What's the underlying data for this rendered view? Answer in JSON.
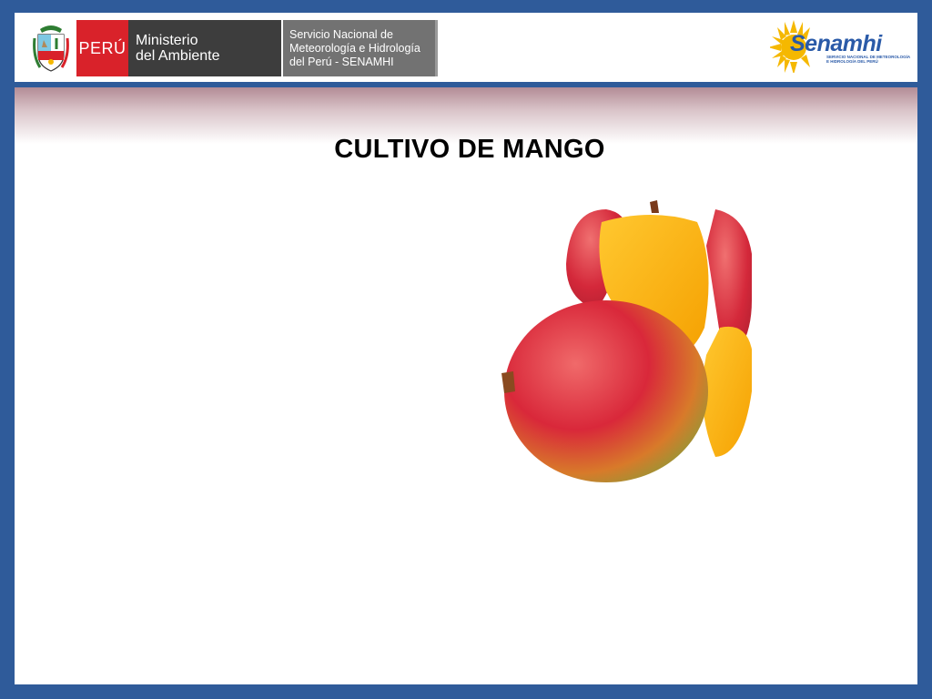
{
  "header": {
    "peru_label": "PERÚ",
    "ministry_line1": "Ministerio",
    "ministry_line2": "del Ambiente",
    "service_line1": "Servicio Nacional de",
    "service_line2": "Meteorología e Hidrología",
    "service_line3": "del Perú - SENAMHI",
    "logo_name": "Senamhi",
    "logo_subtitle": "SERVICIO NACIONAL DE METEOROLOGÍA E HIDROLOGÍA DEL PERÚ"
  },
  "slide": {
    "title": "CULTIVO DE MANGO",
    "image_icon": "mango-fruit-image"
  },
  "colors": {
    "frame": "#2f5b9a",
    "peru_red": "#d9222a",
    "ministry_gray": "#3d3d3d",
    "service_gray": "#727272",
    "logo_blue": "#2a5aa8",
    "logo_sun": "#f5b800"
  }
}
